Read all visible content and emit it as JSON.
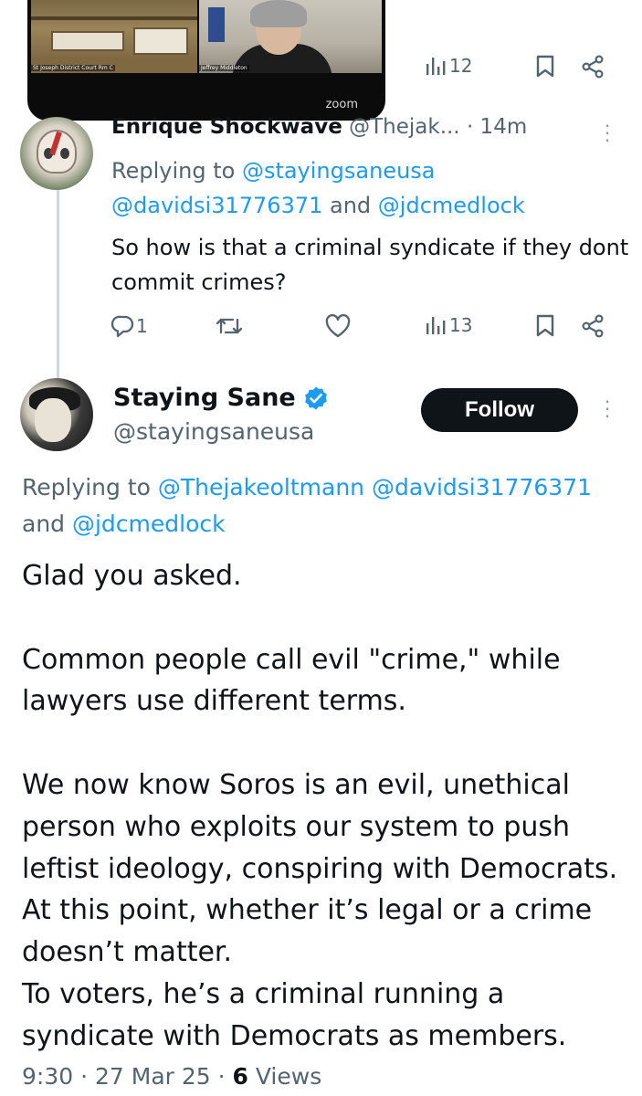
{
  "video": {
    "caption_left": "St Joseph District Court Rm C",
    "caption_right": "Jeffrey Middleton",
    "watermark": "zoom",
    "views_count": "12"
  },
  "reply_tweet": {
    "author_name": "Enrique Shockwave",
    "author_handle": "@Thejak...",
    "time": "· 14m",
    "replying_prefix": "Replying to ",
    "replying_mentions": [
      "@stayingsaneusa",
      "@davidsi31776371",
      "@jdcmedlock"
    ],
    "replying_and": " and ",
    "body": "So how is that a criminal syndicate if they dont commit crimes?",
    "reply_count": "1",
    "retweet_count": "",
    "like_count": "",
    "views_count": "13"
  },
  "main_tweet": {
    "author_name": "Staying Sane",
    "author_handle": "@stayingsaneusa",
    "follow_label": "Follow",
    "replying_prefix": "Replying to ",
    "replying_mentions": [
      "@Thejakeoltmann",
      "@davidsi31776371",
      "@jdcmedlock"
    ],
    "replying_and": "and ",
    "body": "Glad you asked.\n\nCommon people call evil \"crime,\" while lawyers use different terms.\n\nWe now know Soros is an evil, unethical person who exploits our system to push leftist ideology, conspiring with Democrats. At this point, whether it’s legal or a crime doesn’t matter.\nTo voters, he’s a criminal running a syndicate with Democrats as members.",
    "time": "9:30",
    "date": "27 Mar 25",
    "separator": " · ",
    "views_number": "6",
    "views_label": " Views"
  },
  "colors": {
    "text_primary": "#0f1419",
    "text_secondary": "#536471",
    "link": "#1d9bf0",
    "verified": "#1d9bf0",
    "follow_bg": "#0f1419"
  },
  "icons": [
    "views-icon",
    "bookmark-icon",
    "share-icon",
    "reply-icon",
    "retweet-icon",
    "like-icon",
    "verified-badge-icon",
    "more-icon"
  ]
}
